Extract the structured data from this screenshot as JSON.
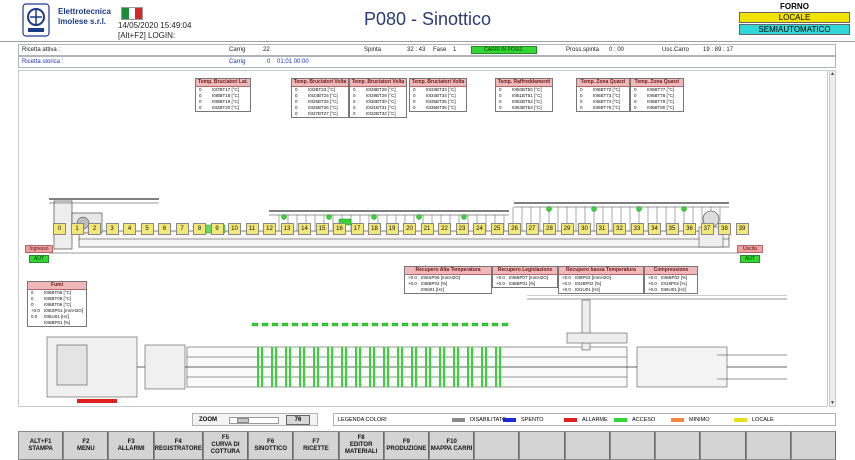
{
  "header": {
    "company_line1": "Elettrotecnica",
    "company_line2": "Imolese s.r.l.",
    "datetime": "14/05/2020 15:49:04",
    "login": "[Alt+F2] LOGIN:",
    "title": "P080 - Sinottico",
    "mode_title": "FORNO",
    "mode_state": "LOCALE",
    "mode_auto": "SEMIAUTOMATICO",
    "flag_colors": [
      "#1e8a3a",
      "#ffffff",
      "#d62828"
    ]
  },
  "info1": {
    "ricetta_attiva": "Ricetta attiva :",
    "carrig_label": "Carrig",
    "carrig_value": "22",
    "spinta_label": "Spinta",
    "spinta_value": "32 : 43",
    "fase_label": "Fase",
    "fase_value": "1",
    "carri_status": "CARRI IN POSIZ.",
    "pross_label": "Pross.spinta",
    "pross_value": "0 : 00",
    "usc_label": "Usc.Carro",
    "usc_value": "19 : 89 : 17"
  },
  "info2": {
    "ricetta_storica": "Ricetta storica :",
    "carrig_label": "Carrig",
    "carrig_value": "0",
    "time_value": "01:01 00:00"
  },
  "top_tables": [
    {
      "title": "Temp. Bruciatori Lat.",
      "rows": [
        [
          "0",
          "I0I7BT17 [°C]"
        ],
        [
          "0",
          "I0I8BT18 [°C]"
        ],
        [
          "0",
          "I0I9BT19 [°C]"
        ],
        [
          "0",
          "I0I2BT20 [°C]"
        ]
      ]
    },
    {
      "title": "Temp. Bruciatori Volta",
      "rows": [
        [
          "0",
          "I0I2BT23 [°C]"
        ],
        [
          "0",
          "I0I24BT24 [°C]"
        ],
        [
          "0",
          "I0I26BT25 [°C]"
        ],
        [
          "0",
          "I0I26BT26 [°C]"
        ],
        [
          "0",
          "I0I27BT27 [°C]"
        ]
      ]
    },
    {
      "title": "Temp. Bruciatori Volta",
      "rows": [
        [
          "0",
          "I0I28BT28 [°C]"
        ],
        [
          "0",
          "I0I29BT29 [°C]"
        ],
        [
          "0",
          "I0I30BT30 [°C]"
        ],
        [
          "0",
          "I0I31BT31 [°C]"
        ],
        [
          "0",
          "I0I32BT32 [°C]"
        ]
      ]
    },
    {
      "title": "Temp. Bruciatori Volta",
      "rows": [
        [
          "0",
          "I0I33BT33 [°C]"
        ],
        [
          "0",
          "I0I34BT34 [°C]"
        ],
        [
          "0",
          "I0I35BT35 [°C]"
        ],
        [
          "0",
          "I0I36BT36 [°C]"
        ]
      ]
    },
    {
      "title": "Temp. Raffreddamenti",
      "rows": [
        [
          "0",
          "I0I50BT50 [°C]"
        ],
        [
          "0",
          "I0I51BT51 [°C]"
        ],
        [
          "0",
          "I0I52BT52 [°C]"
        ],
        [
          "0",
          "I0I53BT53 [°C]"
        ]
      ]
    },
    {
      "title": "Temp. Zona Quarzi",
      "rows": [
        [
          "0",
          "I0I6BT72 [°C]"
        ],
        [
          "0",
          "I0I6BT73 [°C]"
        ],
        [
          "0",
          "I0I6BT74 [°C]"
        ],
        [
          "0",
          "I0I6BT76 [°C]"
        ]
      ]
    },
    {
      "title": "Temp. Zona Quarzi",
      "rows": [
        [
          "0",
          "I0I6BT77 [°C]"
        ],
        [
          "0",
          "I0I6BT78 [°C]"
        ],
        [
          "0",
          "I0I6BT79 [°C]"
        ],
        [
          "0",
          "I0I6BT80 [°C]"
        ]
      ]
    }
  ],
  "cells": [
    "0",
    "1",
    "2",
    "3",
    "4",
    "5",
    "6",
    "7",
    "8",
    "9",
    "10",
    "11",
    "12",
    "13",
    "14",
    "15",
    "16",
    "17",
    "18",
    "19",
    "20",
    "21",
    "22",
    "23",
    "24",
    "25",
    "26",
    "27",
    "28",
    "29",
    "30",
    "31",
    "32",
    "33",
    "34",
    "35",
    "36",
    "37",
    "38",
    "39"
  ],
  "ingresso": {
    "label": "Ingresso",
    "state": "AUT"
  },
  "uscita": {
    "label": "Uscita",
    "state": "AUT"
  },
  "mid_tables": [
    {
      "title": "Recupero Alta Temperatura",
      "rows": [
        [
          "+0.0",
          "I0I6SP06 [mmH2O]"
        ],
        [
          "+0.0",
          "I0I6BP02 [%]"
        ],
        [
          "",
          "I0I6I01 [Hz]"
        ]
      ]
    },
    {
      "title": "Recupero Legislazione",
      "rows": [
        [
          "+0.0",
          "I0I6BP07 [mmH2O]"
        ],
        [
          "+0.0",
          "I0I6BP01 [%]"
        ]
      ]
    },
    {
      "title": "Recupero bassa Temperatura",
      "rows": [
        [
          "+0.0",
          "I0I8P03 [mmH2O]"
        ],
        [
          "+0.0",
          "I0I1BP02 [%]"
        ],
        [
          "+0.0",
          "I0I1U01 [Hz]"
        ]
      ]
    },
    {
      "title": "Compressione",
      "rows": [
        [
          "+0.0",
          "I0I6BP02 [%]"
        ],
        [
          "+0.0",
          "I0I18P02 [%]"
        ],
        [
          "+0.0",
          "I0I6U01 [Hz]"
        ]
      ]
    }
  ],
  "fumi": {
    "title": "Fumi",
    "rows": [
      [
        "0",
        "I0I6BT06 [°C]"
      ],
      [
        "0",
        "I0I6BT09 [°C]"
      ],
      [
        "0",
        "I0I6BT06 [°C]"
      ],
      [
        "+0.0",
        "I0I6SP01 [mmH2O]"
      ],
      [
        "0.0",
        "I0I6U01 [Hz]"
      ],
      [
        "",
        "I0I6BP01 [%]"
      ]
    ]
  },
  "zoom": {
    "label": "ZOOM",
    "value": "76"
  },
  "legend": {
    "title": "LEGENDA COLORI",
    "items": [
      {
        "label": "DISABILITATO",
        "color": "#8a8a8a"
      },
      {
        "label": "SPENTO",
        "color": "#1a2ad6"
      },
      {
        "label": "ALLARME",
        "color": "#e02020"
      },
      {
        "label": "ACCESO",
        "color": "#33d633"
      },
      {
        "label": "MINIMO",
        "color": "#f08a3a"
      },
      {
        "label": "LOCALE",
        "color": "#e6e01a"
      }
    ]
  },
  "fkeys": [
    "ALT+F1\nSTAMPA",
    "F2\nMENU",
    "F3\nALLARMI",
    "F4\nREGISTRATORE",
    "F5\nCURVA DI\nCOTTURA",
    "F6\nSINOTTICO",
    "F7\nRICETTE",
    "F8\nEDITOR\nMATERIALI",
    "F9\nPRODUZIONE",
    "F10\nMAPPA CARRI",
    "",
    "",
    "",
    "",
    "",
    "",
    "",
    ""
  ]
}
